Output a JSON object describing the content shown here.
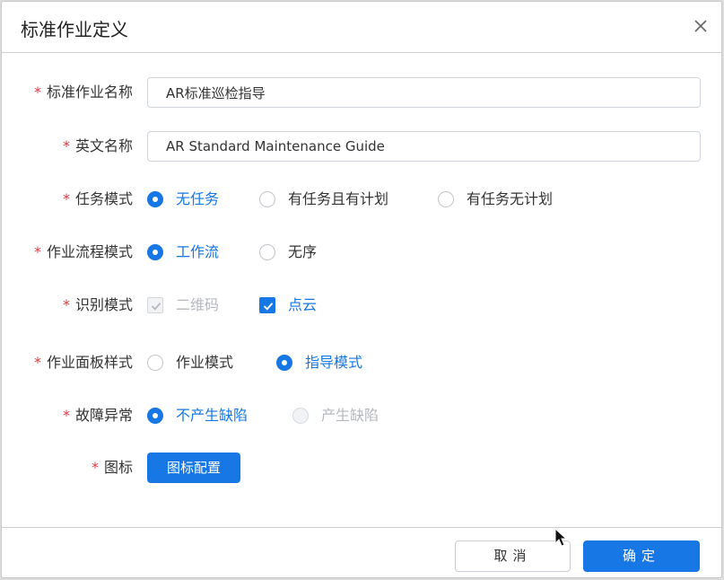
{
  "dialog": {
    "title": "标准作业定义"
  },
  "form": {
    "required_mark": "*",
    "name": {
      "label": "标准作业名称",
      "value": "AR标准巡检指导"
    },
    "english_name": {
      "label": "英文名称",
      "value": "AR Standard Maintenance Guide"
    },
    "task_mode": {
      "label": "任务模式",
      "options": [
        {
          "label": "无任务",
          "selected": true
        },
        {
          "label": "有任务且有计划",
          "selected": false
        },
        {
          "label": "有任务无计划",
          "selected": false
        }
      ]
    },
    "flow_mode": {
      "label": "作业流程模式",
      "options": [
        {
          "label": "工作流",
          "selected": true
        },
        {
          "label": "无序",
          "selected": false
        }
      ]
    },
    "recognition_mode": {
      "label": "识别模式",
      "options": [
        {
          "label": "二维码",
          "checked": true,
          "disabled": true
        },
        {
          "label": "点云",
          "checked": true,
          "disabled": false
        }
      ]
    },
    "panel_style": {
      "label": "作业面板样式",
      "options": [
        {
          "label": "作业模式",
          "selected": false
        },
        {
          "label": "指导模式",
          "selected": true
        }
      ]
    },
    "fault": {
      "label": "故障异常",
      "options": [
        {
          "label": "不产生缺陷",
          "selected": true
        },
        {
          "label": "产生缺陷",
          "selected": false,
          "disabled": true
        }
      ]
    },
    "icon": {
      "label": "图标",
      "button": "图标配置"
    }
  },
  "footer": {
    "cancel": "取消",
    "confirm": "确定"
  },
  "colors": {
    "accent": "#1677e5",
    "required": "#e0383e",
    "disabled_text": "#b4b8be"
  }
}
